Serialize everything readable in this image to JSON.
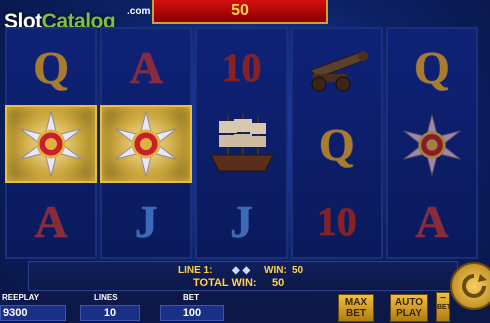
{
  "logo": {
    "main": "Slot",
    "accent": "Catalog",
    "suffix": ".com"
  },
  "top_win": "50",
  "reels": [
    [
      "Q",
      "star-medal",
      "A"
    ],
    [
      "A",
      "star-medal",
      "J"
    ],
    [
      "10",
      "ship",
      "J"
    ],
    [
      "cannon",
      "Q",
      "10"
    ],
    [
      "Q",
      "star-medal",
      "A"
    ]
  ],
  "info": {
    "line_label": "LINE 1:",
    "win_label": "WIN:",
    "win_value": "50",
    "total_label": "TOTAL WIN:",
    "total_value": "50"
  },
  "bottom": {
    "freeplay_label": "REEPLAY",
    "freeplay_value": "9300",
    "lines_label": "LINES",
    "lines_value": "10",
    "bet_label": "BET",
    "bet_value": "100",
    "max_bet_top": "MAX",
    "max_bet_bottom": "BET",
    "auto_top": "AUTO",
    "auto_bottom": "PLAY",
    "bet_minus_label": "BET"
  },
  "colors": {
    "gold": "#ffd24a",
    "red_banner": "#d41010",
    "blue_bg": "#0c2164"
  }
}
